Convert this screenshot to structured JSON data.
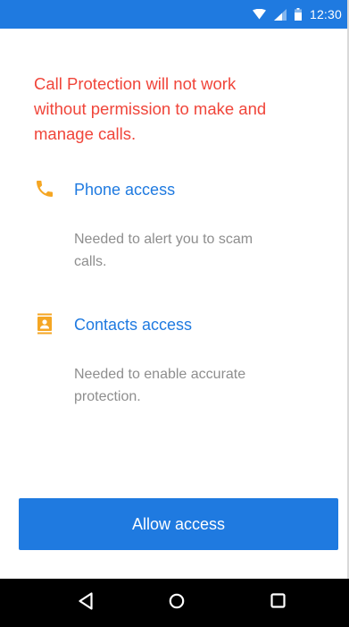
{
  "status_bar": {
    "time": "12:30",
    "icons": [
      "wifi-icon",
      "signal-icon",
      "battery-icon"
    ],
    "background": "#1f7ae0"
  },
  "warning": {
    "lines": [
      "Call Protection will not work",
      "without permission to make and",
      "manage calls."
    ],
    "color": "#f0453a"
  },
  "permissions": [
    {
      "icon": "phone-icon",
      "title": "Phone access",
      "description_lines": [
        "Needed to alert you to scam",
        "calls."
      ]
    },
    {
      "icon": "contacts-icon",
      "title": "Contacts access",
      "description_lines": [
        "Needed to enable accurate",
        "protection."
      ]
    }
  ],
  "button": {
    "label": "Allow access",
    "color": "#1f7ae0"
  },
  "nav_bar": {
    "icons": [
      "back-icon",
      "home-icon",
      "recents-icon"
    ]
  },
  "colors": {
    "accent": "#1f7ae0",
    "warning": "#f0453a",
    "icon_orange": "#f5a623",
    "secondary_text": "#8e8e8e"
  }
}
